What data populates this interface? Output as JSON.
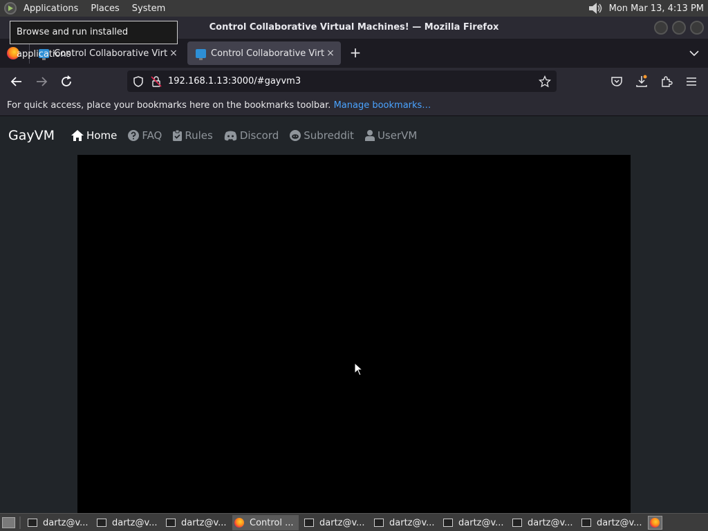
{
  "system_panel": {
    "menus": [
      "Applications",
      "Places",
      "System"
    ],
    "clock": "Mon Mar 13,  4:13 PM"
  },
  "window": {
    "title": "Control Collaborative Virtual Machines! — Mozilla Firefox"
  },
  "tooltip": "Browse and run installed applications",
  "tabs": [
    {
      "label": "Control Collaborative Virtual Machines!",
      "close": "×"
    },
    {
      "label": "Control Collaborative Virtual Machines!",
      "close": "×"
    }
  ],
  "new_tab": "+",
  "address_bar": {
    "url": "192.168.1.13:3000/#gayvm3"
  },
  "bookmarks_toolbar": {
    "message": "For quick access, place your bookmarks here on the bookmarks toolbar.",
    "link": "Manage bookmarks…"
  },
  "site": {
    "brand": "GayVM",
    "nav": [
      {
        "label": "Home",
        "icon": "home-icon"
      },
      {
        "label": "FAQ",
        "icon": "question-circle-icon"
      },
      {
        "label": "Rules",
        "icon": "clipboard-check-icon"
      },
      {
        "label": "Discord",
        "icon": "discord-icon"
      },
      {
        "label": "Subreddit",
        "icon": "reddit-icon"
      },
      {
        "label": "UserVM",
        "icon": "user-icon"
      }
    ]
  },
  "taskbar": {
    "tasks": [
      "dartz@v...",
      "dartz@v...",
      "dartz@v...",
      "Control ...",
      "dartz@v...",
      "dartz@v...",
      "dartz@v...",
      "dartz@v...",
      "dartz@v..."
    ]
  },
  "colors": {
    "page_bg": "#212529",
    "vm_screen": "#000000",
    "link": "#4aa3ff",
    "browser_chrome": "#2b2a33"
  }
}
